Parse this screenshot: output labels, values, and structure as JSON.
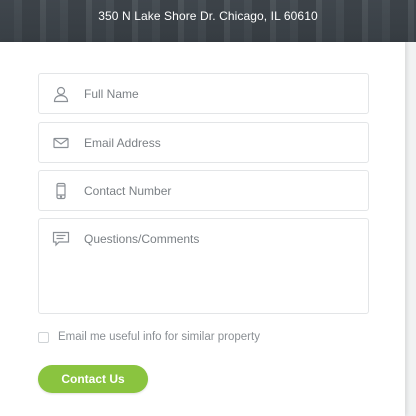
{
  "header": {
    "address": "350 N Lake Shore Dr. Chicago, IL 60610"
  },
  "form": {
    "full_name": {
      "placeholder": "Full Name",
      "value": "",
      "icon": "user-icon"
    },
    "email": {
      "placeholder": "Email Address",
      "value": "",
      "icon": "envelope-icon"
    },
    "phone": {
      "placeholder": "Contact Number",
      "value": "",
      "icon": "mobile-phone-icon"
    },
    "comments": {
      "placeholder": "Questions/Comments",
      "value": "",
      "icon": "chat-bubble-icon"
    },
    "opt_in": {
      "label": "Email me useful info for similar property",
      "checked": false
    },
    "submit_label": "Contact Us"
  },
  "colors": {
    "accent": "#8ac43f",
    "placeholder_text": "#7b8085",
    "field_border": "#e3e5e7"
  }
}
